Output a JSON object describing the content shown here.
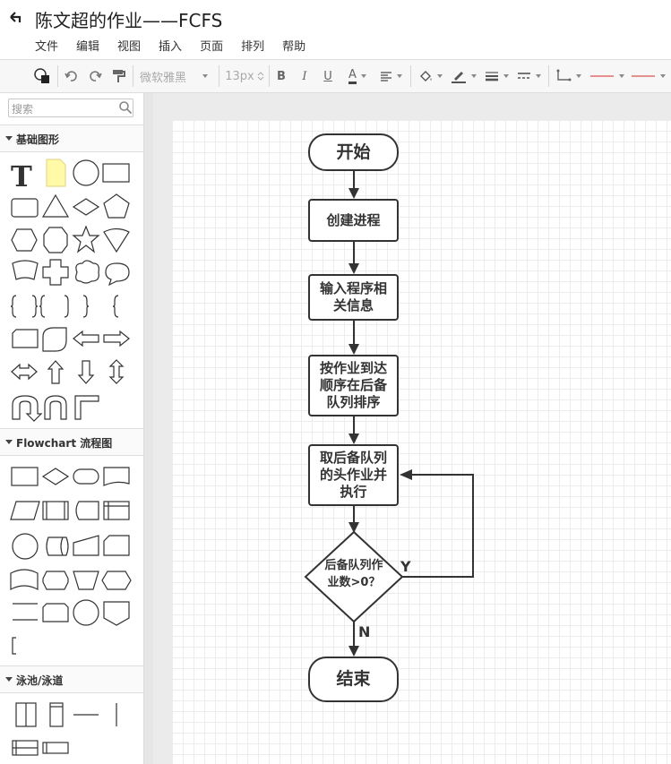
{
  "app": {
    "title": "陈文超的作业——FCFS",
    "menu": [
      "文件",
      "编辑",
      "视图",
      "插入",
      "页面",
      "排列",
      "帮助"
    ]
  },
  "toolbar": {
    "font_family": "微软雅黑",
    "font_size": "13px",
    "bold": "B",
    "italic": "I",
    "underline": "U",
    "font_color": "A"
  },
  "sidebar": {
    "search_placeholder": "搜索",
    "sections": [
      {
        "label": "基础图形"
      },
      {
        "label": "Flowchart 流程图"
      },
      {
        "label": "泳池/泳道"
      }
    ]
  },
  "flowchart": {
    "start": "开始",
    "step1": "创建进程",
    "step2": [
      "输入程序相",
      "关信息"
    ],
    "step3": [
      "按作业到达",
      "顺序在后备",
      "队列排序"
    ],
    "step4": [
      "取后备队列",
      "的头作业并",
      "执行"
    ],
    "decision": [
      "后备队列作",
      "业数>0？"
    ],
    "yes": "Y",
    "no": "N",
    "end": "结束"
  },
  "colors": {
    "accent": "#333333",
    "canvas_bg": "#ebebeb",
    "note_yellow": "#fff9a8"
  }
}
